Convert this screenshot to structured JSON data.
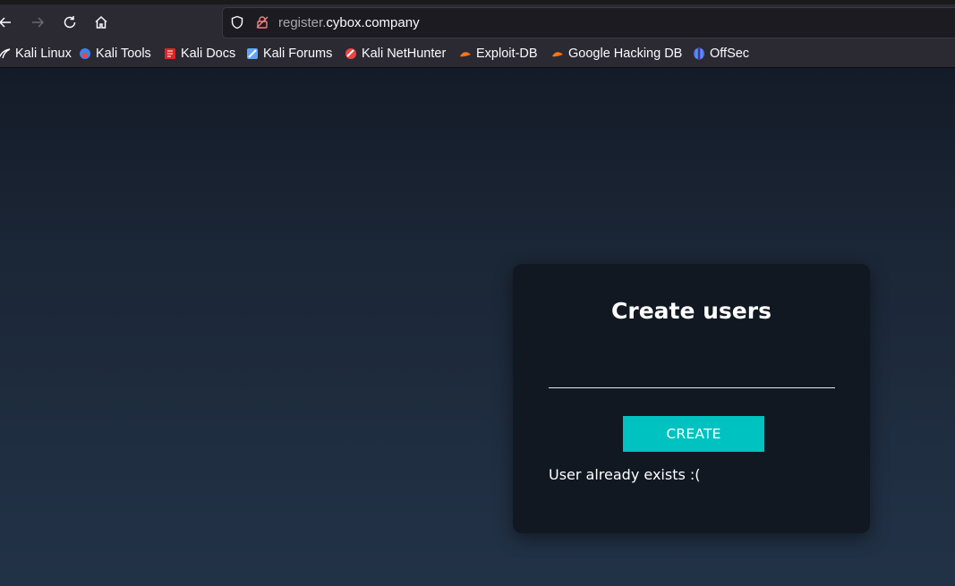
{
  "browser": {
    "url_prefix": "register.",
    "url_domain": "cybox.company",
    "bookmarks": [
      {
        "label": "Kali Linux",
        "icon": "kali-dragon-icon",
        "color": "#ffffff"
      },
      {
        "label": "Kali Tools",
        "icon": "kali-tools-icon",
        "color": "#3b82f6"
      },
      {
        "label": "Kali Docs",
        "icon": "kali-docs-icon",
        "color": "#dc2626"
      },
      {
        "label": "Kali Forums",
        "icon": "kali-forums-icon",
        "color": "#60a5fa"
      },
      {
        "label": "Kali NetHunter",
        "icon": "nethunter-icon",
        "color": "#ef4444"
      },
      {
        "label": "Exploit-DB",
        "icon": "exploit-db-icon",
        "color": "#f97316"
      },
      {
        "label": "Google Hacking DB",
        "icon": "ghdb-icon",
        "color": "#f97316"
      },
      {
        "label": "OffSec",
        "icon": "offsec-icon",
        "color": "#6366f1"
      }
    ]
  },
  "form": {
    "title": "Create users",
    "input_value": "",
    "button_label": "CREATE",
    "message": "User already exists :("
  }
}
